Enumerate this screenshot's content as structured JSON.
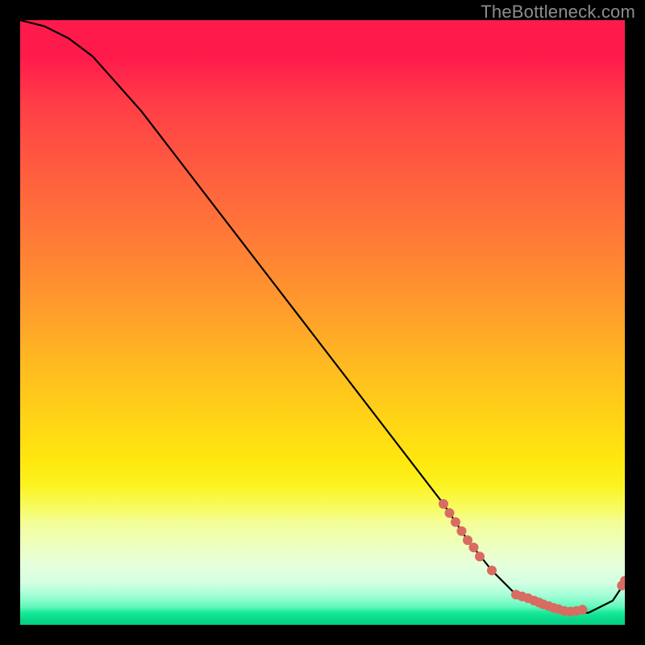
{
  "watermark": "TheBottleneck.com",
  "chart_data": {
    "type": "line",
    "title": "",
    "xlabel": "",
    "ylabel": "",
    "xlim": [
      0,
      100
    ],
    "ylim": [
      0,
      100
    ],
    "series": [
      {
        "name": "curve",
        "x": [
          0,
          4,
          8,
          12,
          20,
          30,
          40,
          50,
          60,
          70,
          74,
          78,
          82,
          86,
          90,
          94,
          98,
          100
        ],
        "y": [
          100,
          99,
          97,
          94,
          85,
          72,
          59,
          46,
          33,
          20,
          14,
          9,
          5,
          3,
          2,
          2,
          4,
          7
        ]
      }
    ],
    "markers": {
      "name": "dots",
      "color": "#d86b62",
      "points": [
        {
          "x": 70,
          "y": 20
        },
        {
          "x": 71,
          "y": 18.5
        },
        {
          "x": 72,
          "y": 17
        },
        {
          "x": 73,
          "y": 15.5
        },
        {
          "x": 74,
          "y": 14
        },
        {
          "x": 75,
          "y": 12.8
        },
        {
          "x": 76,
          "y": 11.3
        },
        {
          "x": 78,
          "y": 9
        },
        {
          "x": 82,
          "y": 5
        },
        {
          "x": 83,
          "y": 4.7
        },
        {
          "x": 84,
          "y": 4.4
        },
        {
          "x": 85,
          "y": 4
        },
        {
          "x": 85.8,
          "y": 3.7
        },
        {
          "x": 86.5,
          "y": 3.4
        },
        {
          "x": 87.4,
          "y": 3.1
        },
        {
          "x": 88.2,
          "y": 2.8
        },
        {
          "x": 89,
          "y": 2.6
        },
        {
          "x": 90,
          "y": 2.3
        },
        {
          "x": 91,
          "y": 2.2
        },
        {
          "x": 92,
          "y": 2.3
        },
        {
          "x": 93,
          "y": 2.5
        },
        {
          "x": 99.5,
          "y": 6.5
        },
        {
          "x": 100,
          "y": 7.3
        }
      ]
    }
  }
}
